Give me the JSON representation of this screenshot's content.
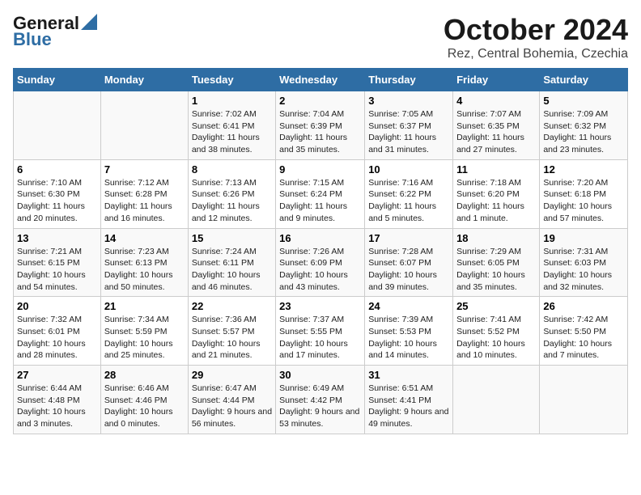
{
  "header": {
    "logo_general": "General",
    "logo_blue": "Blue",
    "title": "October 2024",
    "subtitle": "Rez, Central Bohemia, Czechia"
  },
  "days_of_week": [
    "Sunday",
    "Monday",
    "Tuesday",
    "Wednesday",
    "Thursday",
    "Friday",
    "Saturday"
  ],
  "weeks": [
    [
      {
        "day": "",
        "info": ""
      },
      {
        "day": "",
        "info": ""
      },
      {
        "day": "1",
        "info": "Sunrise: 7:02 AM\nSunset: 6:41 PM\nDaylight: 11 hours and 38 minutes."
      },
      {
        "day": "2",
        "info": "Sunrise: 7:04 AM\nSunset: 6:39 PM\nDaylight: 11 hours and 35 minutes."
      },
      {
        "day": "3",
        "info": "Sunrise: 7:05 AM\nSunset: 6:37 PM\nDaylight: 11 hours and 31 minutes."
      },
      {
        "day": "4",
        "info": "Sunrise: 7:07 AM\nSunset: 6:35 PM\nDaylight: 11 hours and 27 minutes."
      },
      {
        "day": "5",
        "info": "Sunrise: 7:09 AM\nSunset: 6:32 PM\nDaylight: 11 hours and 23 minutes."
      }
    ],
    [
      {
        "day": "6",
        "info": "Sunrise: 7:10 AM\nSunset: 6:30 PM\nDaylight: 11 hours and 20 minutes."
      },
      {
        "day": "7",
        "info": "Sunrise: 7:12 AM\nSunset: 6:28 PM\nDaylight: 11 hours and 16 minutes."
      },
      {
        "day": "8",
        "info": "Sunrise: 7:13 AM\nSunset: 6:26 PM\nDaylight: 11 hours and 12 minutes."
      },
      {
        "day": "9",
        "info": "Sunrise: 7:15 AM\nSunset: 6:24 PM\nDaylight: 11 hours and 9 minutes."
      },
      {
        "day": "10",
        "info": "Sunrise: 7:16 AM\nSunset: 6:22 PM\nDaylight: 11 hours and 5 minutes."
      },
      {
        "day": "11",
        "info": "Sunrise: 7:18 AM\nSunset: 6:20 PM\nDaylight: 11 hours and 1 minute."
      },
      {
        "day": "12",
        "info": "Sunrise: 7:20 AM\nSunset: 6:18 PM\nDaylight: 10 hours and 57 minutes."
      }
    ],
    [
      {
        "day": "13",
        "info": "Sunrise: 7:21 AM\nSunset: 6:15 PM\nDaylight: 10 hours and 54 minutes."
      },
      {
        "day": "14",
        "info": "Sunrise: 7:23 AM\nSunset: 6:13 PM\nDaylight: 10 hours and 50 minutes."
      },
      {
        "day": "15",
        "info": "Sunrise: 7:24 AM\nSunset: 6:11 PM\nDaylight: 10 hours and 46 minutes."
      },
      {
        "day": "16",
        "info": "Sunrise: 7:26 AM\nSunset: 6:09 PM\nDaylight: 10 hours and 43 minutes."
      },
      {
        "day": "17",
        "info": "Sunrise: 7:28 AM\nSunset: 6:07 PM\nDaylight: 10 hours and 39 minutes."
      },
      {
        "day": "18",
        "info": "Sunrise: 7:29 AM\nSunset: 6:05 PM\nDaylight: 10 hours and 35 minutes."
      },
      {
        "day": "19",
        "info": "Sunrise: 7:31 AM\nSunset: 6:03 PM\nDaylight: 10 hours and 32 minutes."
      }
    ],
    [
      {
        "day": "20",
        "info": "Sunrise: 7:32 AM\nSunset: 6:01 PM\nDaylight: 10 hours and 28 minutes."
      },
      {
        "day": "21",
        "info": "Sunrise: 7:34 AM\nSunset: 5:59 PM\nDaylight: 10 hours and 25 minutes."
      },
      {
        "day": "22",
        "info": "Sunrise: 7:36 AM\nSunset: 5:57 PM\nDaylight: 10 hours and 21 minutes."
      },
      {
        "day": "23",
        "info": "Sunrise: 7:37 AM\nSunset: 5:55 PM\nDaylight: 10 hours and 17 minutes."
      },
      {
        "day": "24",
        "info": "Sunrise: 7:39 AM\nSunset: 5:53 PM\nDaylight: 10 hours and 14 minutes."
      },
      {
        "day": "25",
        "info": "Sunrise: 7:41 AM\nSunset: 5:52 PM\nDaylight: 10 hours and 10 minutes."
      },
      {
        "day": "26",
        "info": "Sunrise: 7:42 AM\nSunset: 5:50 PM\nDaylight: 10 hours and 7 minutes."
      }
    ],
    [
      {
        "day": "27",
        "info": "Sunrise: 6:44 AM\nSunset: 4:48 PM\nDaylight: 10 hours and 3 minutes."
      },
      {
        "day": "28",
        "info": "Sunrise: 6:46 AM\nSunset: 4:46 PM\nDaylight: 10 hours and 0 minutes."
      },
      {
        "day": "29",
        "info": "Sunrise: 6:47 AM\nSunset: 4:44 PM\nDaylight: 9 hours and 56 minutes."
      },
      {
        "day": "30",
        "info": "Sunrise: 6:49 AM\nSunset: 4:42 PM\nDaylight: 9 hours and 53 minutes."
      },
      {
        "day": "31",
        "info": "Sunrise: 6:51 AM\nSunset: 4:41 PM\nDaylight: 9 hours and 49 minutes."
      },
      {
        "day": "",
        "info": ""
      },
      {
        "day": "",
        "info": ""
      }
    ]
  ]
}
